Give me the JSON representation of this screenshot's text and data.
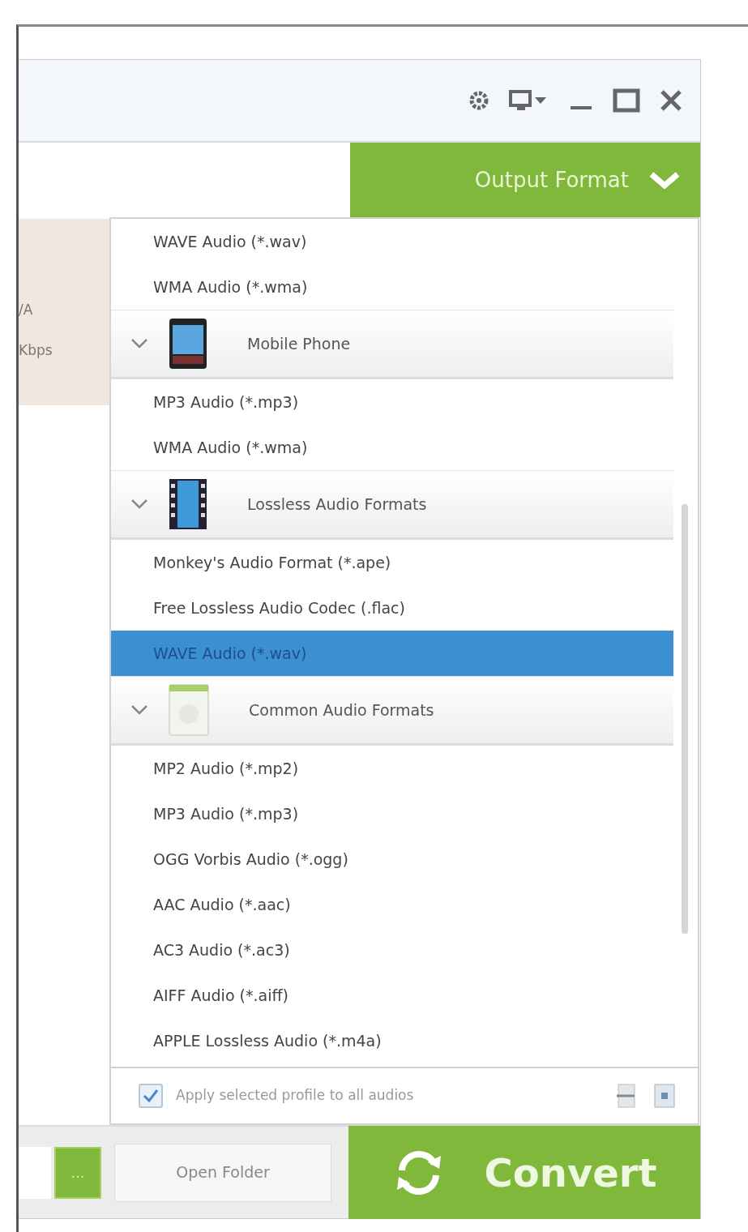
{
  "window": {
    "controls": [
      {
        "kind": "settings"
      },
      {
        "kind": "display"
      },
      {
        "kind": "minimize"
      },
      {
        "kind": "maximize"
      },
      {
        "kind": "close"
      }
    ]
  },
  "output_format": {
    "label": "Output Format"
  },
  "left_panel": {
    "texts": [
      "/A",
      "Kbps"
    ]
  },
  "format_list": [
    {
      "kind": "format",
      "label": "WAVE Audio (*.wav)",
      "selected": false
    },
    {
      "kind": "format",
      "label": "WMA Audio (*.wma)",
      "selected": false
    },
    {
      "kind": "category",
      "label": "Mobile Phone",
      "expanded": true,
      "children": [
        {
          "kind": "format",
          "label": "MP3 Audio (*.mp3)",
          "selected": false
        },
        {
          "kind": "format",
          "label": "WMA Audio (*.wma)",
          "selected": false
        }
      ]
    },
    {
      "kind": "category",
      "label": "Lossless Audio Formats",
      "expanded": true,
      "children": [
        {
          "kind": "format",
          "label": "Monkey's Audio Format (*.ape)",
          "selected": false
        },
        {
          "kind": "format",
          "label": "Free Lossless Audio Codec (.flac)",
          "selected": false
        },
        {
          "kind": "format",
          "label": "WAVE Audio (*.wav)",
          "selected": true
        }
      ]
    },
    {
      "kind": "category",
      "label": "Common Audio Formats",
      "expanded": true,
      "children": [
        {
          "kind": "format",
          "label": "MP2 Audio (*.mp2)",
          "selected": false
        },
        {
          "kind": "format",
          "label": "MP3 Audio (*.mp3)",
          "selected": false
        },
        {
          "kind": "format",
          "label": "OGG Vorbis Audio (*.ogg)",
          "selected": false
        },
        {
          "kind": "format",
          "label": "AAC Audio (*.aac)",
          "selected": false
        },
        {
          "kind": "format",
          "label": "AC3 Audio (*.ac3)",
          "selected": false
        },
        {
          "kind": "format",
          "label": "AIFF Audio (*.aiff)",
          "selected": false
        },
        {
          "kind": "format",
          "label": "APPLE Lossless Audio (*.m4a)",
          "selected": false
        }
      ]
    }
  ],
  "apply_all": {
    "label": "Apply selected profile to all audios",
    "checked": true
  },
  "bottom_bar": {
    "browse": "...",
    "open_folder": "Open Folder",
    "convert": "Convert"
  }
}
